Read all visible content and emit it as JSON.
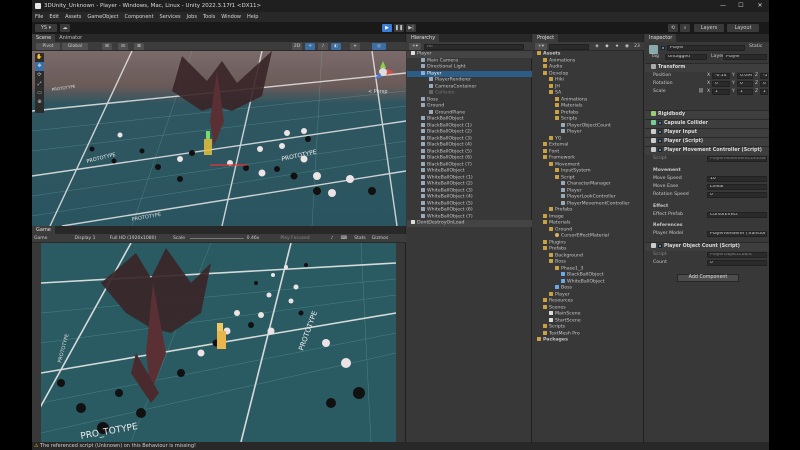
{
  "window": {
    "title": "3DUnity_Unknown - Player - Windows, Mac, Linux - Unity 2022.3.17f1 <DX11>",
    "controls": [
      "—",
      "☐",
      "✕"
    ]
  },
  "menu": [
    "File",
    "Edit",
    "Assets",
    "GameObject",
    "Component",
    "Services",
    "Jobs",
    "Tools",
    "Window",
    "Help"
  ],
  "toolbar": {
    "account": "YS ▾",
    "cloud": "☁",
    "layers": "Layers",
    "layout": "Layout",
    "play": "▶",
    "pause": "❚❚",
    "step": "▶|"
  },
  "scene": {
    "tabs": [
      "Scene",
      "Animator"
    ],
    "tool_chips": [
      "Pivot",
      "Global",
      "⊞",
      "⊟",
      "⊠",
      "2D",
      "☀",
      "♪",
      "◐",
      "⌖",
      "◎"
    ],
    "persp_label": "< Persp",
    "floor_text": [
      "PROTOTYPE",
      "PROTOTYPE",
      "PROTOTYPE",
      "PROTOTYPE"
    ]
  },
  "game": {
    "tab": "Game",
    "display_mode": "Game",
    "display": "Display 1",
    "resolution": "Full HD (1920x1080)",
    "scale_label": "Scale",
    "scale_value": "0.46x",
    "play_focused": "Play Focused",
    "stats": "Stats",
    "gizmos": "Gizmos",
    "floor_text": [
      "PROTOTYPE",
      "PROTOTYPE",
      "PRO_TOTYPE"
    ]
  },
  "hierarchy": {
    "tab": "Hierarchy",
    "search_placeholder": "All",
    "items": [
      "Player",
      "Main Camera",
      "Directional Light",
      "Player",
      "PlayerRenderer",
      "CameraContainer",
      "Collision",
      "Boss",
      "Ground",
      "GroundPlane",
      "BlackBallObject",
      "BlackBallObject (1)",
      "BlackBallObject (2)",
      "BlackBallObject (3)",
      "BlackBallObject (4)",
      "BlackBallObject (5)",
      "BlackBallObject (6)",
      "BlackBallObject (7)",
      "WhiteBallObject",
      "WhiteBallObject (1)",
      "WhiteBallObject (2)",
      "WhiteBallObject (3)",
      "WhiteBallObject (4)",
      "WhiteBallObject (5)",
      "WhiteBallObject (6)",
      "WhiteBallObject (7)",
      "DontDestroyOnLoad"
    ]
  },
  "project": {
    "tab": "Project",
    "count": "23",
    "items": [
      "Assets",
      "Animations",
      "Audio",
      "Develop",
      "Hiki",
      "JH",
      "SA",
      "Animations",
      "Materials",
      "Prefabs",
      "Scripts",
      "PlayerObjectCount",
      "Player",
      "YG",
      "External",
      "Font",
      "Framework",
      "Movement",
      "InputSystem",
      "Script",
      "CharacterManager",
      "Player",
      "PlayerLookController",
      "PlayerMovementController",
      "Prefabs",
      "Image",
      "Materials",
      "Ground",
      "CursorEffectMaterial",
      "Plugins",
      "Prefabs",
      "Background",
      "Boss",
      "Phase1_3",
      "BlackBallObject",
      "WhiteBallObject",
      "Boss",
      "Player",
      "Resources",
      "Scenes",
      "MainScene",
      "StartScene",
      "Scripts",
      "TextMesh Pro",
      "Packages"
    ]
  },
  "inspector": {
    "tab": "Inspector",
    "object_name": "Player",
    "static_label": "Static",
    "tag_label": "Tag",
    "tag_value": "Untagged",
    "layer_label": "Layer",
    "layer_value": "Player",
    "transform": {
      "name": "Transform",
      "position_label": "Position",
      "rotation_label": "Rotation",
      "scale_label": "Scale",
      "pos": {
        "x": "-0.14",
        "y": "0.09999",
        "z": "-12.08"
      },
      "rot": {
        "x": "0",
        "y": "0",
        "z": "0"
      },
      "scl": {
        "x": "1",
        "y": "1",
        "z": "1"
      },
      "axis": {
        "x": "X",
        "y": "Y",
        "z": "Z"
      }
    },
    "components": [
      "Rigidbody",
      "Capsule Collider",
      "Player Input",
      "Player (Script)",
      "Player Movement Controller (Script)"
    ],
    "pmc": {
      "script_label": "Script",
      "script_value": "PlayerMovementController",
      "movement_header": "Movement",
      "move_speed_label": "Move Speed",
      "move_speed_value": "10",
      "move_ease_label": "Move Ease",
      "move_ease_value": "Linear",
      "rotation_speed_label": "Rotation Speed",
      "rotation_speed_value": "0",
      "effect_header": "Effect",
      "effect_prefab_label": "Effect Prefab",
      "effect_prefab_value": "CursorEffect",
      "references_header": "References",
      "player_model_label": "Player Model",
      "player_model_value": "PlayerRenderer (Transform)"
    },
    "poc": {
      "name": "Player Object Count (Script)",
      "script_label": "Script",
      "script_value": "PlayerObjectCount",
      "count_label": "Count",
      "count_value": "0"
    },
    "add_component": "Add Component"
  },
  "status": {
    "message": "The referenced script (Unknown) on this Behaviour is missing!"
  },
  "colors": {
    "accent": "#3b7bd4",
    "selection": "#2c5d87",
    "warning": "#e6b800"
  }
}
